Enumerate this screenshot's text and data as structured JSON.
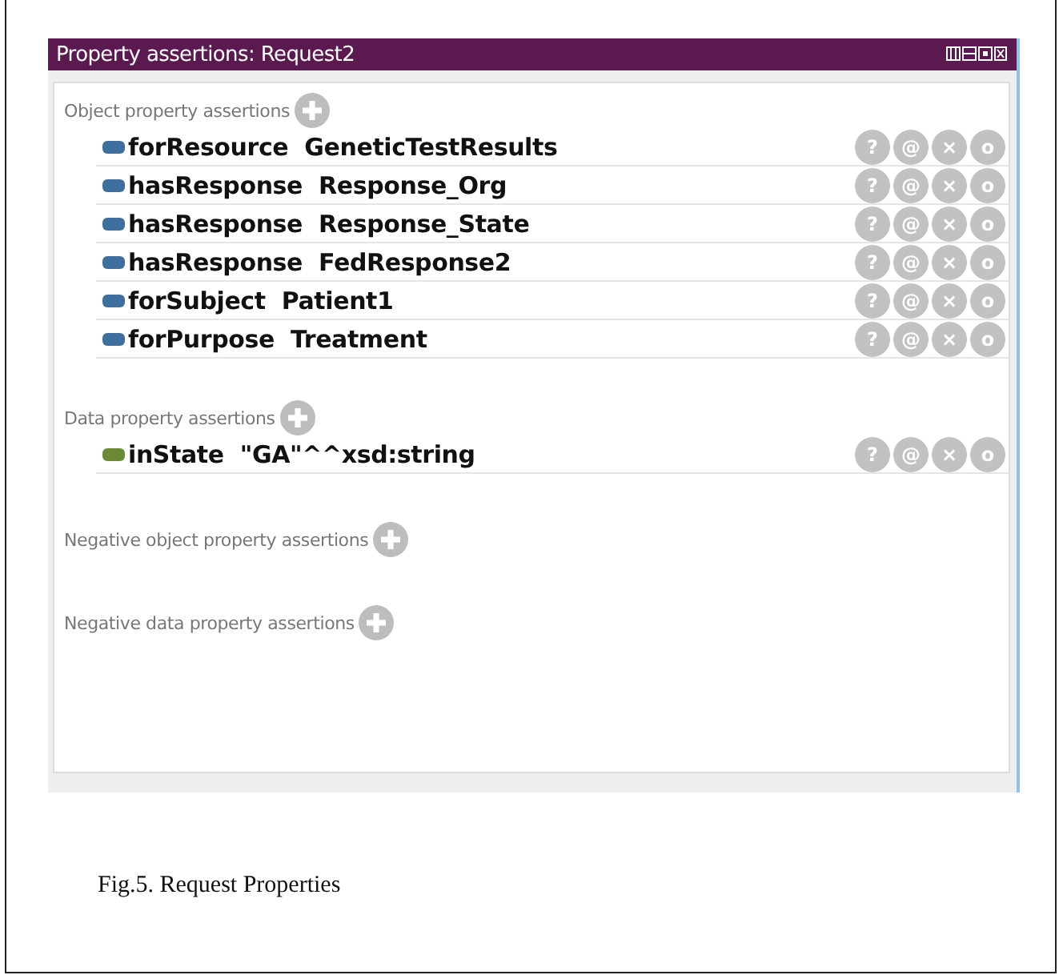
{
  "panel": {
    "title": "Property assertions: Request2"
  },
  "sections": [
    {
      "label": "Object property assertions",
      "kind": "object",
      "rows": [
        {
          "property": "forResource",
          "value": "GeneticTestResults",
          "actions": [
            "?",
            "@",
            "×",
            "o"
          ]
        },
        {
          "property": "hasResponse",
          "value": "Response_Org",
          "actions": [
            "?",
            "@",
            "×",
            "o"
          ]
        },
        {
          "property": "hasResponse",
          "value": "Response_State",
          "actions": [
            "?",
            "@",
            "×",
            "o"
          ]
        },
        {
          "property": "hasResponse",
          "value": "FedResponse2",
          "actions": [
            "?",
            "@",
            "×",
            "o"
          ]
        },
        {
          "property": "forSubject",
          "value": "Patient1",
          "actions": [
            "?",
            "@",
            "×",
            "o"
          ]
        },
        {
          "property": "forPurpose",
          "value": "Treatment",
          "actions": [
            "?",
            "@",
            "×",
            "o"
          ]
        }
      ]
    },
    {
      "label": "Data property assertions",
      "kind": "data",
      "rows": [
        {
          "property": "inState",
          "value": "\"GA\"^^xsd:string",
          "actions": [
            "?",
            "@",
            "×",
            "o"
          ]
        }
      ]
    },
    {
      "label": "Negative object property assertions",
      "kind": "negative"
    },
    {
      "label": "Negative data property assertions",
      "kind": "negative"
    }
  ],
  "caption": "Fig.5. Request Properties"
}
